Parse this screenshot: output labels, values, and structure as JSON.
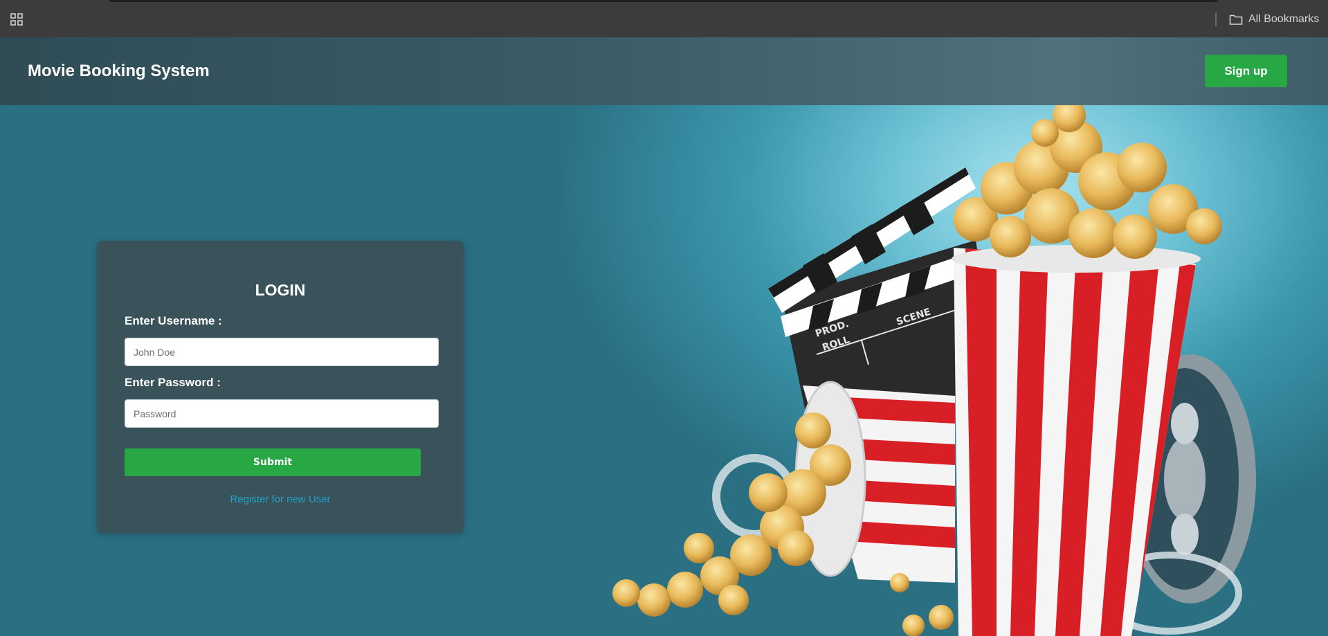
{
  "browser": {
    "apps_icon": "apps-grid-icon",
    "bookmarks_label": "All Bookmarks",
    "bookmarks_icon": "folder-icon"
  },
  "header": {
    "title": "Movie Booking System",
    "signup_label": "Sign up"
  },
  "login": {
    "title": "LOGIN",
    "username_label": "Enter Username :",
    "username_placeholder": "John Doe",
    "username_value": "",
    "password_label": "Enter Password :",
    "password_placeholder": "Password",
    "password_value": "",
    "submit_label": "Submit",
    "register_link": "Register for new User"
  },
  "colors": {
    "accent_green": "#28a745",
    "link_blue": "#1fa2c9",
    "header_bg": "#3a5d67",
    "card_bg": "#3c4e54"
  },
  "hero_image": {
    "depicts": [
      "popcorn-bucket-large",
      "popcorn-bucket-tipped",
      "clapperboard",
      "film-reel",
      "film-strip"
    ],
    "clapperboard_text": [
      "PROD.",
      "ROLL",
      "SCENE"
    ]
  }
}
